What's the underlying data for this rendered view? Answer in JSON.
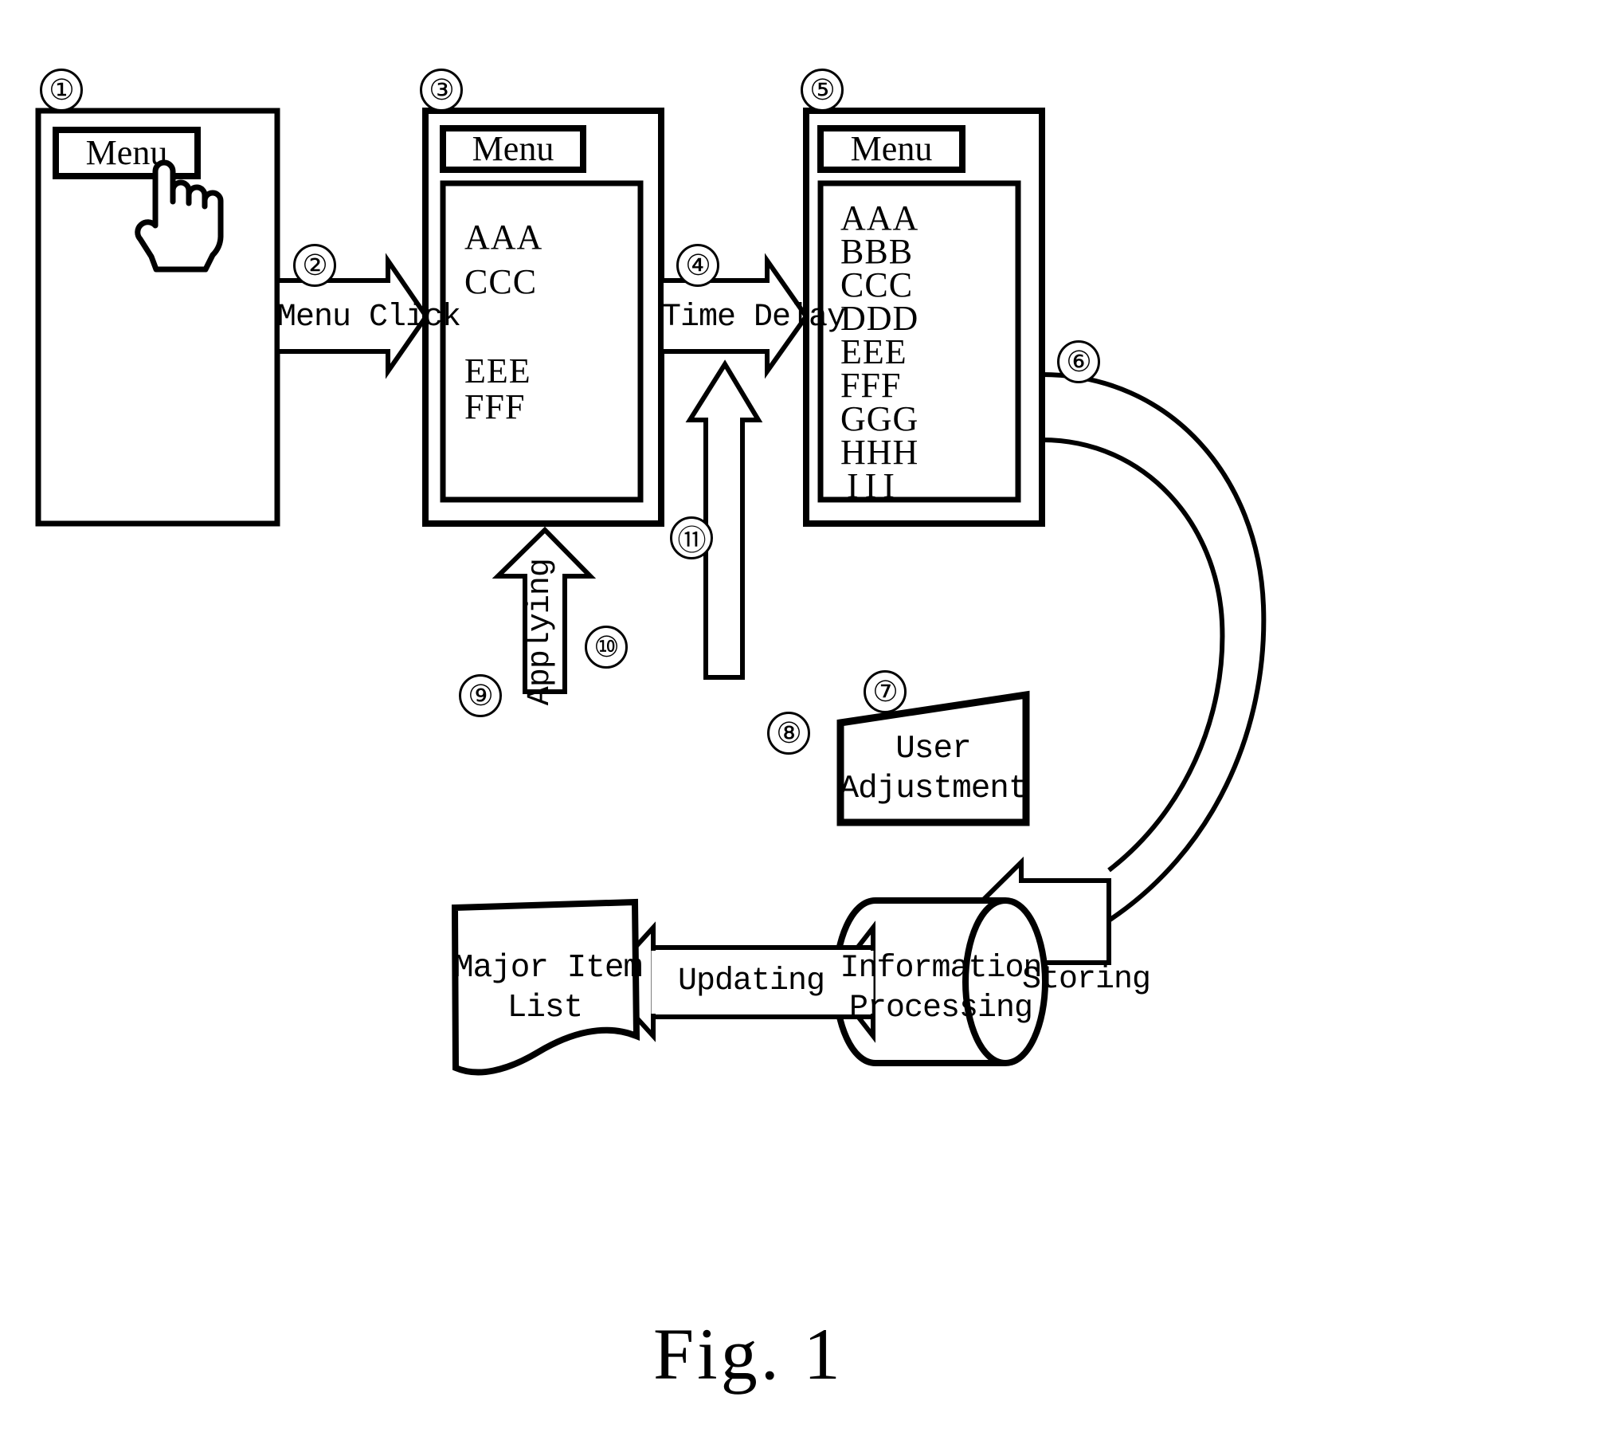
{
  "figure": {
    "caption": "Fig. 1",
    "title_text": "Fig. 1"
  },
  "screens": {
    "screen1": {
      "ref": "①",
      "menu_button_label": "Menu",
      "cursor_icon": "pointing-hand-cursor",
      "items": []
    },
    "screen3": {
      "ref": "③",
      "menu_button_label": "Menu",
      "items": [
        "AAA",
        "CCC",
        "",
        "EEE",
        "FFF"
      ]
    },
    "screen5": {
      "ref": "⑤",
      "menu_button_label": "Menu",
      "items": [
        "AAA",
        "BBB",
        "CCC",
        "DDD",
        "EEE",
        "FFF",
        "GGG",
        "HHH",
        "III"
      ]
    }
  },
  "arrows": {
    "menu_click": {
      "ref": "②",
      "label": "Menu Click",
      "direction": "right"
    },
    "time_delay": {
      "ref": "④",
      "label": "Time Delay",
      "direction": "right"
    },
    "storing": {
      "ref": "⑥",
      "label": "Storing",
      "direction": "left"
    },
    "updating": {
      "ref": "⑧",
      "label": "Updating",
      "direction": "left"
    },
    "applying": {
      "ref": "⑩",
      "label": "Applying",
      "direction": "up"
    },
    "user_adjust_arrow": {
      "label": "",
      "direction": "up"
    }
  },
  "nodes": {
    "user_adjustment": {
      "ref": "⑪",
      "label_line1": "User",
      "label_line2": "Adjustment"
    },
    "major_item_list": {
      "ref": "⑨",
      "label_line1": "Major Item",
      "label_line2": "List"
    },
    "information_processing": {
      "ref": "⑦",
      "label_line1": "Information",
      "label_line2": "Processing"
    }
  },
  "style": {
    "ink": "#000000",
    "paper": "#ffffff"
  }
}
